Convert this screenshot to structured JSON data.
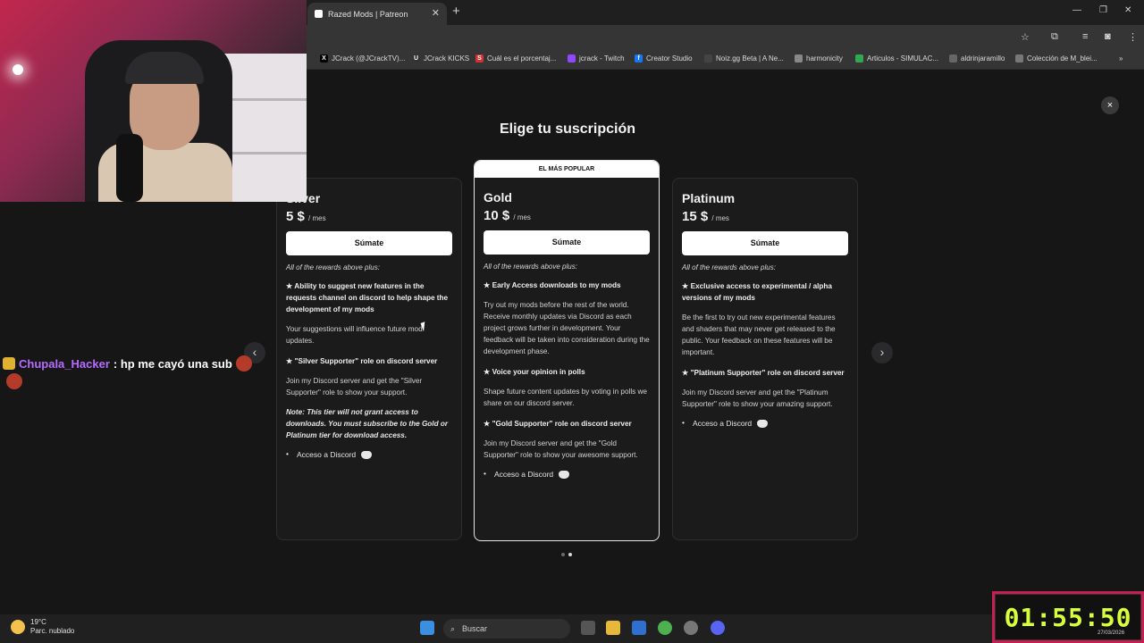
{
  "browser": {
    "tab_title": "Razed Mods | Patreon",
    "new_tab": "+",
    "bookmarks": [
      {
        "label": "JCrack (@JCrackTV)...",
        "icon": "x-icon",
        "color": "#000000"
      },
      {
        "label": "JCrack KICKS",
        "icon": "bookmark-icon",
        "color": "#333333"
      },
      {
        "label": "Cuál es el porcentaj...",
        "icon": "s-icon",
        "color": "#d33232"
      },
      {
        "label": "jcrack - Twitch",
        "icon": "twitch-icon",
        "color": "#9146ff"
      },
      {
        "label": "Creator Studio",
        "icon": "facebook-icon",
        "color": "#1877f2"
      },
      {
        "label": "Noiz.gg Beta | A Ne...",
        "icon": "noiz-icon",
        "color": "#444444"
      },
      {
        "label": "harmonicity",
        "icon": "harmonicity-icon",
        "color": "#888888"
      },
      {
        "label": "Articulos - SIMULAC...",
        "icon": "drive-icon",
        "color": "#2fa84f"
      },
      {
        "label": "aldrinjaramillo",
        "icon": "profile-icon",
        "color": "#666666"
      },
      {
        "label": "Colección de M_blei...",
        "icon": "doc-icon",
        "color": "#777777"
      }
    ]
  },
  "modal": {
    "title": "Elige tu suscripción",
    "close": "×",
    "popular_badge": "EL MÁS POPULAR",
    "per_month": "/ mes",
    "join_label": "Súmate",
    "rewards_intro": "All of the rewards above plus:",
    "tiers": [
      {
        "name": "Silver",
        "price": "5 $",
        "rewards": [
          {
            "type": "b",
            "text": "★ Ability to suggest new features in the requests channel on discord to help shape the development of my mods"
          },
          {
            "type": "p",
            "text": "Your suggestions will influence future mod updates."
          },
          {
            "type": "b",
            "text": "★ \"Silver Supporter\" role on discord server"
          },
          {
            "type": "p",
            "text": "Join my Discord server and get the \"Silver Supporter\" role to show your support."
          },
          {
            "type": "note",
            "text": "Note: This tier will not grant access to downloads. You must subscribe to the Gold or Platinum tier for download access."
          }
        ],
        "perk": "Acceso a Discord"
      },
      {
        "name": "Gold",
        "price": "10 $",
        "rewards": [
          {
            "type": "b",
            "text": "★ Early Access downloads to my mods"
          },
          {
            "type": "p",
            "text": "Try out my mods before the rest of the world. Receive monthly updates via Discord as each project grows further in development. Your feedback will be taken into consideration during the development phase."
          },
          {
            "type": "b",
            "text": "★ Voice your opinion in polls"
          },
          {
            "type": "p",
            "text": "Shape future content updates by voting in polls we share on our discord server."
          },
          {
            "type": "b",
            "text": "★ \"Gold Supporter\" role on discord server"
          },
          {
            "type": "p",
            "text": "Join my Discord server and get the \"Gold Supporter\" role to show your awesome support."
          }
        ],
        "perk": "Acceso a Discord"
      },
      {
        "name": "Platinum",
        "price": "15 $",
        "rewards": [
          {
            "type": "b",
            "text": "★ Exclusive access to experimental / alpha versions of my mods"
          },
          {
            "type": "p",
            "text": "Be the first to try out new experimental features and shaders that may never get released to the public. Your feedback on these features will be important."
          },
          {
            "type": "b",
            "text": "★ \"Platinum Supporter\" role on discord server"
          },
          {
            "type": "p",
            "text": "Join my Discord server and get the \"Platinum Supporter\" role to show your amazing support."
          }
        ],
        "perk": "Acceso a Discord"
      }
    ]
  },
  "chat": {
    "user": "Chupala_Hacker",
    "message": ": hp me cayó una sub"
  },
  "taskbar": {
    "temperature": "19°C",
    "weather": "Parc. nublado",
    "search_placeholder": "Buscar"
  },
  "timer": {
    "value": "01:55:50",
    "date": "27/03/2026"
  }
}
